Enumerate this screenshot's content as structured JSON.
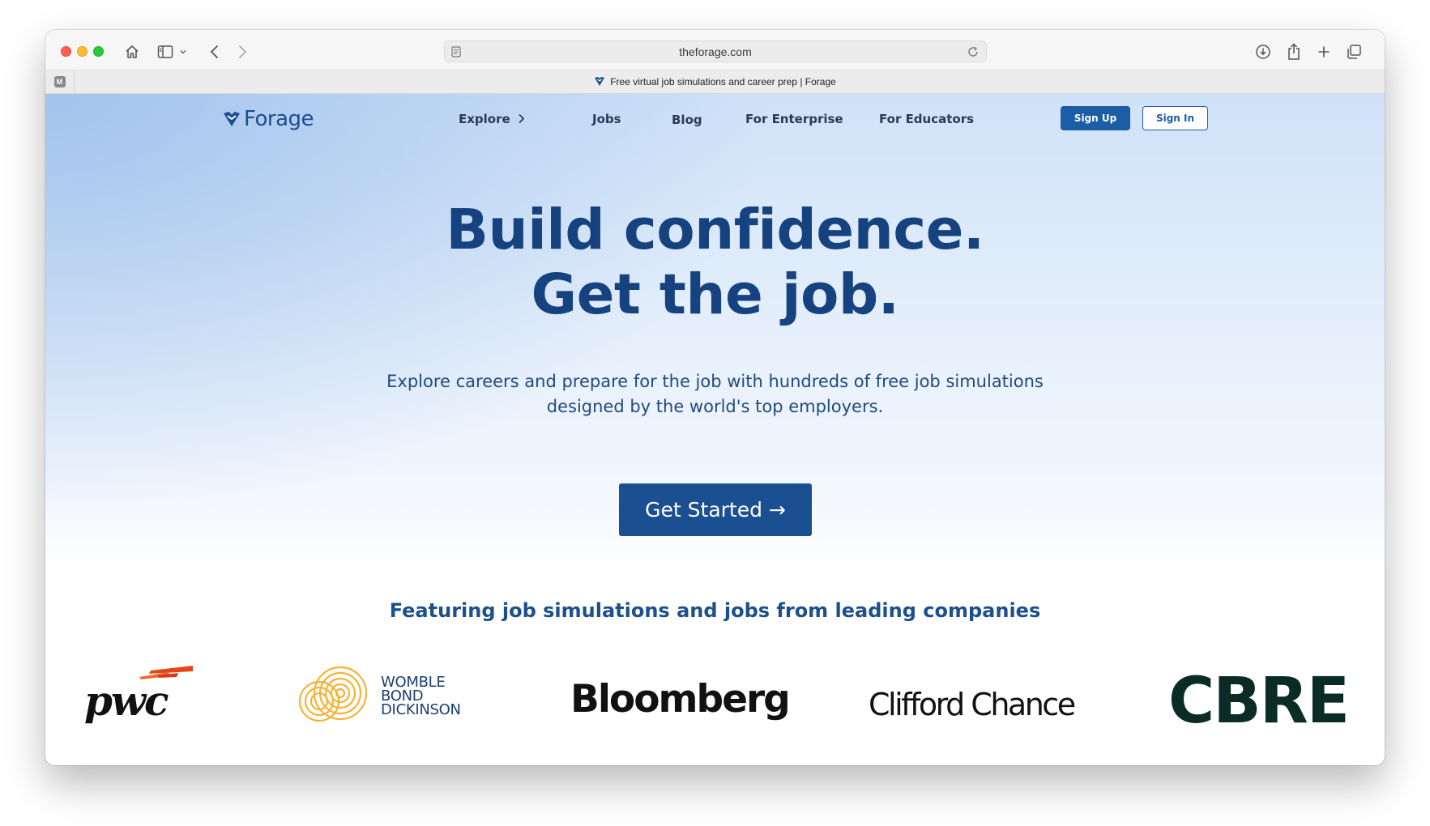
{
  "browser": {
    "url": "theforage.com",
    "tab_title": "Free virtual job simulations and career prep | Forage",
    "pinned_tab_badge": "M"
  },
  "nav": {
    "logo": "Forage",
    "explore": "Explore",
    "jobs": "Jobs",
    "blog": "Blog",
    "enterprise": "For Enterprise",
    "educators": "For Educators",
    "sign_up": "Sign Up",
    "sign_in": "Sign In"
  },
  "hero": {
    "title_line1": "Build confidence.",
    "title_line2": "Get the job.",
    "subtitle_line1": "Explore careers and prepare for the job with hundreds of free job simulations",
    "subtitle_line2": "designed by the world's top employers.",
    "cta": "Get Started →"
  },
  "featured": {
    "heading": "Featuring job simulations and jobs from leading companies",
    "companies": {
      "pwc": "pwc",
      "womble_line1": "WOMBLE",
      "womble_line2": "BOND",
      "womble_line3": "DICKINSON",
      "bloomberg": "Bloomberg",
      "clifford": "Clifford Chance",
      "cbre": "CBRE"
    }
  },
  "colors": {
    "brand_blue": "#1b4f8e",
    "cta_blue": "#1a4f91",
    "pwc_orange": "#e8441c",
    "womble_gold": "#f5b335",
    "cbre_green": "#0b2b26"
  }
}
